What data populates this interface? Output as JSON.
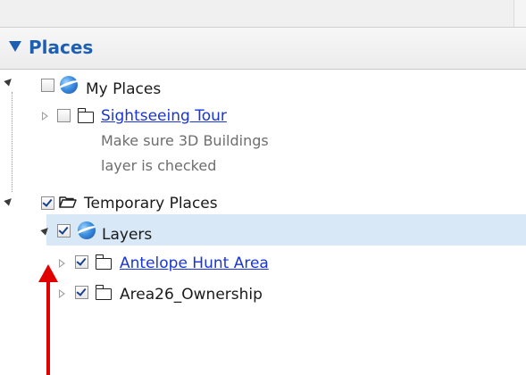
{
  "panel": {
    "title": "Places"
  },
  "tree": {
    "my_places": {
      "label": "My Places",
      "checked": false,
      "icon": "globe-icon",
      "children": {
        "sightseeing": {
          "label": "Sightseeing Tour",
          "checked": false,
          "icon": "folder-icon",
          "description_lines": [
            "Make sure 3D Buildings",
            "layer is checked"
          ]
        }
      }
    },
    "temporary_places": {
      "label": "Temporary Places",
      "checked": true,
      "icon": "open-folder-icon",
      "children": {
        "layers": {
          "label": "Layers",
          "checked": true,
          "selected": true,
          "icon": "globe-icon",
          "children": {
            "antelope": {
              "label": "Antelope Hunt Area",
              "checked": true,
              "icon": "folder-icon"
            },
            "area26": {
              "label": "Area26_Ownership",
              "checked": true,
              "icon": "folder-icon"
            }
          }
        }
      }
    }
  },
  "annotation": {
    "arrow_color": "#e00000",
    "arrow_direction": "up"
  },
  "colors": {
    "header_text": "#1f5fb0",
    "link": "#1a35d6",
    "selection": "#d9e8f6"
  }
}
